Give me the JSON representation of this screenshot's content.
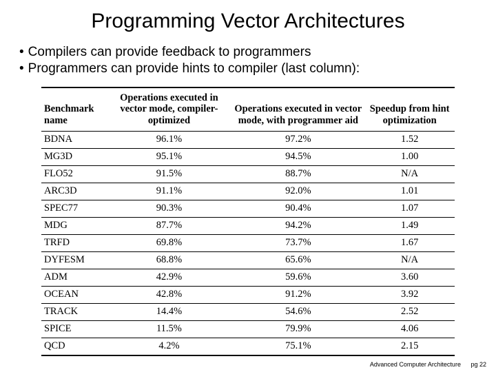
{
  "title": "Programming Vector Architectures",
  "bullets": [
    "Compilers can provide feedback to programmers",
    "Programmers can provide hints to compiler (last column):"
  ],
  "chart_data": {
    "type": "table",
    "headers": {
      "benchmark": "Benchmark name",
      "compiler": "Operations executed in vector mode, compiler-optimized",
      "programmer": "Operations executed in vector mode, with programmer aid",
      "speedup": "Speedup from hint optimization"
    },
    "rows": [
      {
        "name": "BDNA",
        "compiler": "96.1%",
        "programmer": "97.2%",
        "speedup": "1.52"
      },
      {
        "name": "MG3D",
        "compiler": "95.1%",
        "programmer": "94.5%",
        "speedup": "1.00"
      },
      {
        "name": "FLO52",
        "compiler": "91.5%",
        "programmer": "88.7%",
        "speedup": "N/A"
      },
      {
        "name": "ARC3D",
        "compiler": "91.1%",
        "programmer": "92.0%",
        "speedup": "1.01"
      },
      {
        "name": "SPEC77",
        "compiler": "90.3%",
        "programmer": "90.4%",
        "speedup": "1.07"
      },
      {
        "name": "MDG",
        "compiler": "87.7%",
        "programmer": "94.2%",
        "speedup": "1.49"
      },
      {
        "name": "TRFD",
        "compiler": "69.8%",
        "programmer": "73.7%",
        "speedup": "1.67"
      },
      {
        "name": "DYFESM",
        "compiler": "68.8%",
        "programmer": "65.6%",
        "speedup": "N/A"
      },
      {
        "name": "ADM",
        "compiler": "42.9%",
        "programmer": "59.6%",
        "speedup": "3.60"
      },
      {
        "name": "OCEAN",
        "compiler": "42.8%",
        "programmer": "91.2%",
        "speedup": "3.92"
      },
      {
        "name": "TRACK",
        "compiler": "14.4%",
        "programmer": "54.6%",
        "speedup": "2.52"
      },
      {
        "name": "SPICE",
        "compiler": "11.5%",
        "programmer": "79.9%",
        "speedup": "4.06"
      },
      {
        "name": "QCD",
        "compiler": "4.2%",
        "programmer": "75.1%",
        "speedup": "2.15"
      }
    ]
  },
  "footer": {
    "course": "Advanced Computer Architecture",
    "page": "pg 22"
  }
}
